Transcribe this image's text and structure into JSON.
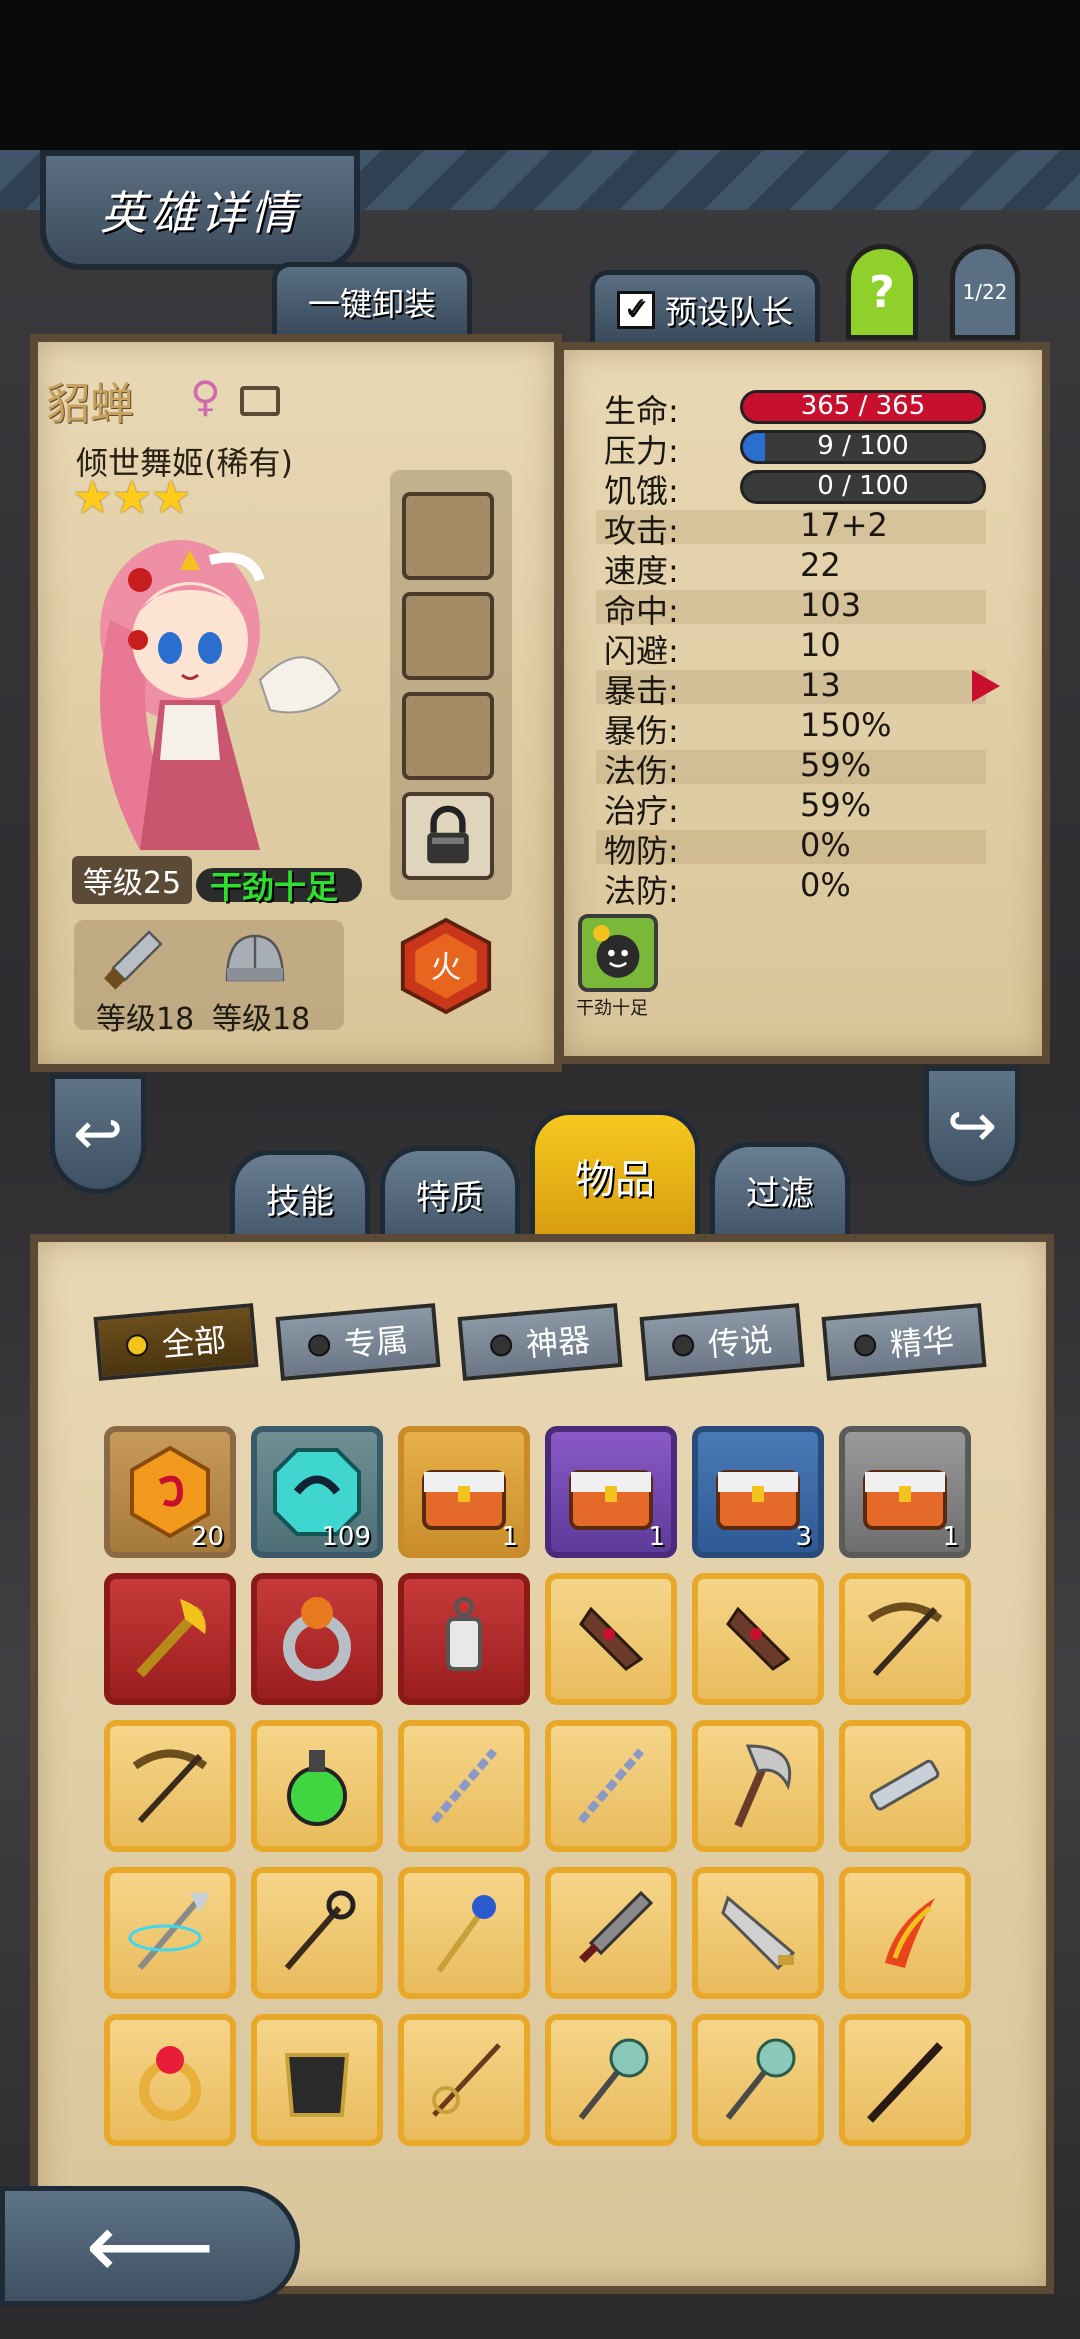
{
  "header": {
    "title": "英雄详情",
    "unequip_all": "一键卸装",
    "preset_leader": "预设队长",
    "help": "?",
    "pager": "1/22"
  },
  "hero": {
    "name": "貂蝉",
    "gender_symbol": "♀",
    "title": "倾世舞姬(稀有)",
    "stars": "★★★",
    "level_label": "等级25",
    "mood": "干劲十足",
    "weapon_level": "等级18",
    "armor_level": "等级18",
    "element": "火"
  },
  "stats": {
    "hp_label": "生命:",
    "hp_value": "365 / 365",
    "hp_fraction": 1.0,
    "stress_label": "压力:",
    "stress_value": "9 / 100",
    "stress_fraction": 0.09,
    "hunger_label": "饥饿:",
    "hunger_value": "0 / 100",
    "hunger_fraction": 0.0,
    "rows": [
      {
        "label": "攻击:",
        "value": "17+2"
      },
      {
        "label": "速度:",
        "value": "22"
      },
      {
        "label": "命中:",
        "value": "103"
      },
      {
        "label": "闪避:",
        "value": "10"
      },
      {
        "label": "暴击:",
        "value": "13"
      },
      {
        "label": "暴伤:",
        "value": "150%"
      },
      {
        "label": "法伤:",
        "value": "59%"
      },
      {
        "label": "治疗:",
        "value": "59%"
      },
      {
        "label": "物防:",
        "value": "0%"
      },
      {
        "label": "法防:",
        "value": "0%"
      }
    ],
    "buff_label": "干劲十足"
  },
  "tabs": [
    "技能",
    "特质",
    "物品",
    "过滤"
  ],
  "active_tab": "物品",
  "filters": [
    "全部",
    "专属",
    "神器",
    "传说",
    "精华"
  ],
  "items": [
    {
      "icon": "orange-gem-icon",
      "rarity": "bronze",
      "count": "20"
    },
    {
      "icon": "cyan-gem-icon",
      "rarity": "cyan",
      "count": "109"
    },
    {
      "icon": "orange-chest-icon",
      "rarity": "orange",
      "count": "1"
    },
    {
      "icon": "purple-chest-icon",
      "rarity": "purple",
      "count": "1"
    },
    {
      "icon": "blue-chest-icon",
      "rarity": "blue",
      "count": "3"
    },
    {
      "icon": "gray-chest-icon",
      "rarity": "gray",
      "count": "1"
    },
    {
      "icon": "golden-axe-icon",
      "rarity": "red",
      "count": ""
    },
    {
      "icon": "ring-icon",
      "rarity": "red",
      "count": ""
    },
    {
      "icon": "lantern-icon",
      "rarity": "red",
      "count": ""
    },
    {
      "icon": "hammer-icon",
      "rarity": "gold",
      "count": ""
    },
    {
      "icon": "hammer-icon",
      "rarity": "gold",
      "count": ""
    },
    {
      "icon": "crossbow-icon",
      "rarity": "gold",
      "count": ""
    },
    {
      "icon": "crossbow-icon",
      "rarity": "gold",
      "count": ""
    },
    {
      "icon": "potion-icon",
      "rarity": "gold",
      "count": ""
    },
    {
      "icon": "chain-icon",
      "rarity": "gold",
      "count": ""
    },
    {
      "icon": "chain-icon",
      "rarity": "gold",
      "count": ""
    },
    {
      "icon": "battle-axe-icon",
      "rarity": "gold",
      "count": ""
    },
    {
      "icon": "gun-icon",
      "rarity": "gold",
      "count": ""
    },
    {
      "icon": "spear-icon",
      "rarity": "gold",
      "count": ""
    },
    {
      "icon": "staff-icon",
      "rarity": "gold",
      "count": ""
    },
    {
      "icon": "orb-staff-icon",
      "rarity": "gold",
      "count": ""
    },
    {
      "icon": "sword-icon",
      "rarity": "gold",
      "count": ""
    },
    {
      "icon": "cleaver-icon",
      "rarity": "gold",
      "count": ""
    },
    {
      "icon": "flame-sword-icon",
      "rarity": "gold",
      "count": ""
    },
    {
      "icon": "ruby-ring-icon",
      "rarity": "gold",
      "count": ""
    },
    {
      "icon": "armor-icon",
      "rarity": "gold",
      "count": ""
    },
    {
      "icon": "rapier-icon",
      "rarity": "gold",
      "count": ""
    },
    {
      "icon": "mace-icon",
      "rarity": "gold",
      "count": ""
    },
    {
      "icon": "mace-icon",
      "rarity": "gold",
      "count": ""
    },
    {
      "icon": "cane-icon",
      "rarity": "gold",
      "count": ""
    }
  ],
  "colors": {
    "hp": "#c8102e",
    "stress": "#2a6fd0",
    "active_tab": "#f2c21d",
    "mood": "#30e030"
  }
}
